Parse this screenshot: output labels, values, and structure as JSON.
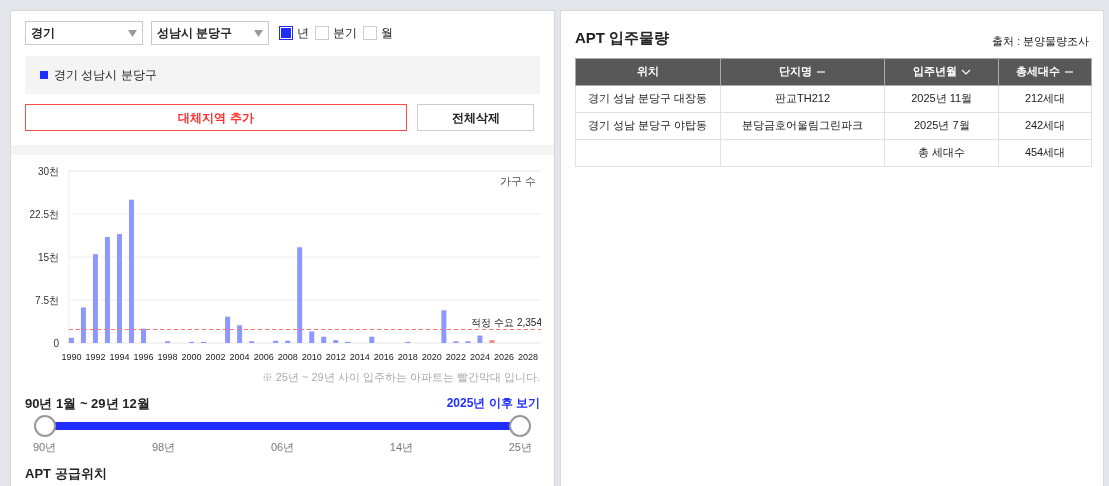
{
  "filters": {
    "selects": [
      {
        "value": "경기"
      },
      {
        "value": "성남시 분당구"
      }
    ],
    "periods": [
      {
        "label": "년",
        "checked": true
      },
      {
        "label": "분기",
        "checked": false
      },
      {
        "label": "월",
        "checked": false
      }
    ]
  },
  "legend": {
    "label": "경기 성남시 분당구",
    "color": "#1f2dff"
  },
  "buttons": [
    {
      "label": "대체지역 추가",
      "kind": "primary"
    },
    {
      "label": "전체삭제",
      "kind": "plain"
    }
  ],
  "chart_data": {
    "type": "bar",
    "ylabel": "가구 수",
    "x": [
      1990,
      1991,
      1992,
      1993,
      1994,
      1995,
      1996,
      1997,
      1998,
      1999,
      2000,
      2001,
      2002,
      2003,
      2004,
      2005,
      2006,
      2007,
      2008,
      2009,
      2010,
      2011,
      2012,
      2013,
      2014,
      2015,
      2016,
      2017,
      2018,
      2019,
      2020,
      2021,
      2022,
      2023,
      2024,
      2025,
      2026,
      2027,
      2028
    ],
    "series": [
      {
        "color": "#8c98ff",
        "values": [
          0.9,
          6.2,
          15.5,
          18.5,
          19,
          25,
          2.5,
          0,
          0.3,
          0,
          0.2,
          0.2,
          0,
          4.6,
          3.1,
          0.3,
          0,
          0.4,
          0.4,
          16.7,
          2,
          1.1,
          0.5,
          0.2,
          0,
          1.1,
          0,
          0,
          0.2,
          0,
          0,
          5.7,
          0.3,
          0.3,
          1.3,
          null,
          null,
          null,
          null
        ]
      },
      {
        "color": "#ff8a8a",
        "values": [
          null,
          null,
          null,
          null,
          null,
          null,
          null,
          null,
          null,
          null,
          null,
          null,
          null,
          null,
          null,
          null,
          null,
          null,
          null,
          null,
          null,
          null,
          null,
          null,
          null,
          null,
          null,
          null,
          null,
          null,
          null,
          null,
          null,
          null,
          null,
          0.5,
          0,
          0,
          0
        ]
      }
    ],
    "xlim": [
      1989.8,
      2029.5
    ],
    "ylim": [
      0,
      30
    ],
    "yticks": [
      {
        "value": 0,
        "label": "0"
      },
      {
        "value": 7.5,
        "label": "7.5천"
      },
      {
        "value": 15,
        "label": "15천"
      },
      {
        "value": 22.5,
        "label": "22.5천"
      },
      {
        "value": 30,
        "label": "30천"
      }
    ],
    "xticks": [
      1990,
      1992,
      1994,
      1996,
      1998,
      2000,
      2002,
      2004,
      2006,
      2008,
      2010,
      2012,
      2014,
      2016,
      2018,
      2020,
      2022,
      2024,
      2026,
      2028
    ],
    "grid": true,
    "ref_lines": [
      {
        "axis": "y",
        "value": 2.354,
        "label": "적정 수요 2,354"
      }
    ]
  },
  "chart_note": "※ 25년 ~ 29년 사이 입주하는 아파트는 빨간막대 입니다.",
  "range": {
    "title": "90년 1월 ~ 29년 12월",
    "link": "2025년 이후 보기",
    "thumbs": [
      {
        "level": 0
      },
      {
        "level": 1
      }
    ],
    "ticks": [
      "90년",
      "98년",
      "06년",
      "14년",
      "25년"
    ]
  },
  "next_section": "APT 공급위치",
  "right": {
    "title": "APT 입주물량",
    "source": "출처 : 분양물량조사",
    "table": {
      "columns": [
        {
          "label": "위치",
          "kind": "plain"
        },
        {
          "label": "단지명",
          "kind": "dash"
        },
        {
          "label": "입주년월",
          "kind": "down"
        },
        {
          "label": "총세대수",
          "kind": "dash"
        }
      ],
      "rows": [
        [
          "경기 성남 분당구 대장동",
          "판교TH212",
          "2025년 11월",
          "212세대"
        ],
        [
          "경기 성남 분당구 야탑동",
          "분당금호어울림그린파크",
          "2025년 7월",
          "242세대"
        ],
        [
          "",
          "",
          "총 세대수",
          "454세대"
        ]
      ]
    }
  }
}
